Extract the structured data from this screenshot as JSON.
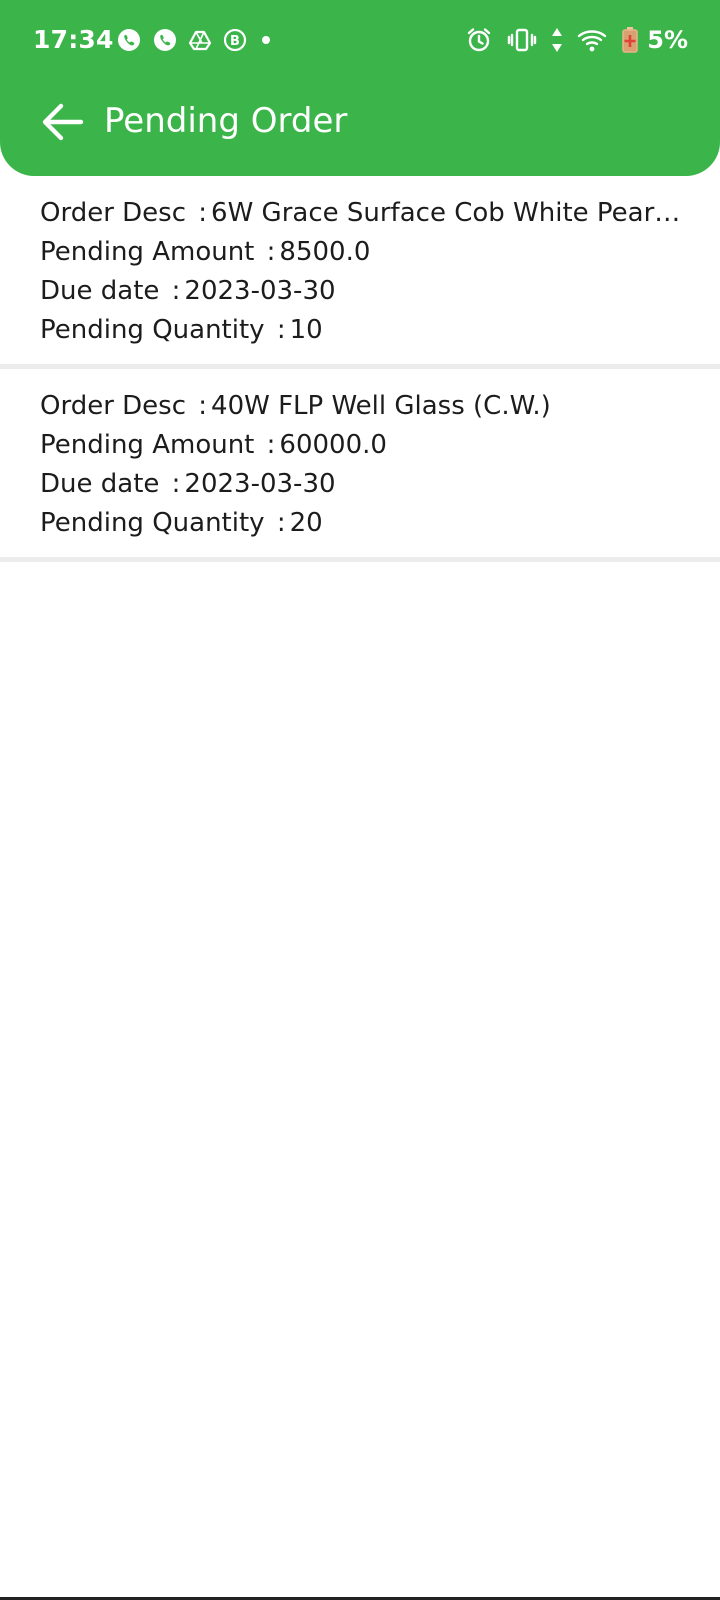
{
  "status_bar": {
    "time": "17:34",
    "battery_percent": "5%",
    "notification_icons": [
      "whatsapp-icon",
      "whatsapp-icon",
      "drive-icon",
      "whatsapp-business-icon",
      "dot-icon"
    ],
    "system_icons": [
      "alarm-icon",
      "vibrate-icon",
      "data-arrows-icon",
      "wifi-icon",
      "battery-low-icon"
    ]
  },
  "toolbar": {
    "title": "Pending Order",
    "back_icon": "arrow-left-icon"
  },
  "labels": {
    "desc": "Order Desc",
    "amount": "Pending Amount",
    "due": "Due date",
    "qty": "Pending Quantity",
    "separator": ":"
  },
  "orders": [
    {
      "desc": "6W Grace Surface Cob White Pearl...",
      "amount": "8500.0",
      "due_date": "2023-03-30",
      "quantity": "10"
    },
    {
      "desc": "40W FLP Well Glass (C.W.)",
      "amount": "60000.0",
      "due_date": "2023-03-30",
      "quantity": "20"
    }
  ],
  "colors": {
    "primary": "#3bb54a",
    "divider": "#ececec",
    "text": "#1c1c1c"
  }
}
